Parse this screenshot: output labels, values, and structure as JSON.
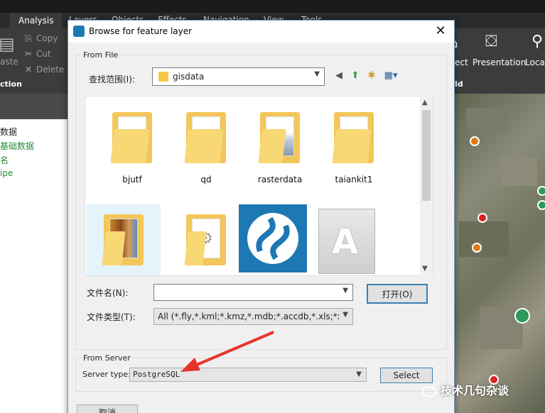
{
  "app": {
    "tabs": [
      "Analysis",
      "Layers",
      "Objects",
      "Effects",
      "Navigation",
      "View",
      "Tools"
    ],
    "clipboard": {
      "copy": "Copy",
      "cut": "Cut",
      "delete": "Delete",
      "paste_partial": "aste",
      "section_partial": "ction"
    },
    "ribbon_right": {
      "select_partial": "ect",
      "presentation": "Presentation",
      "location_partial": "Locati",
      "group_partial": "ld"
    },
    "tree_items": [
      "数据",
      "基础数据",
      "名",
      "ipe"
    ]
  },
  "dialog": {
    "title": "Browse for feature layer",
    "from_file_label": "From File",
    "look_in_label": "查找范围(I):",
    "look_in_value": "gisdata",
    "files": [
      {
        "name": "bjutf",
        "kind": "folder"
      },
      {
        "name": "qd",
        "kind": "folder"
      },
      {
        "name": "rasterdata",
        "kind": "folder"
      },
      {
        "name": "taiankit1",
        "kind": "folder"
      },
      {
        "name": "",
        "kind": "folder-image"
      },
      {
        "name": "",
        "kind": "folder-settings"
      },
      {
        "name": "",
        "kind": "app-logo"
      },
      {
        "name": "",
        "kind": "file"
      }
    ],
    "filename_label": "文件名(N):",
    "filename_value": "",
    "filetype_label": "文件类型(T):",
    "filetype_value": "All (*.fly,*.kml;*.kmz,*.mdb;*.accdb,*.xls;*xlsx,*",
    "open_button": "打开(O)",
    "from_server_label": "From Server",
    "server_type_label": "Server type:",
    "server_type_value": "PostgreSQL",
    "select_button": "Select",
    "cancel_button_partial": "取消"
  },
  "watermark": "技术几句杂谈",
  "colors": {
    "accent": "#3c7fb1",
    "folder": "#f3c65a",
    "logo": "#1e78b4",
    "arrow": "#e8332a"
  }
}
